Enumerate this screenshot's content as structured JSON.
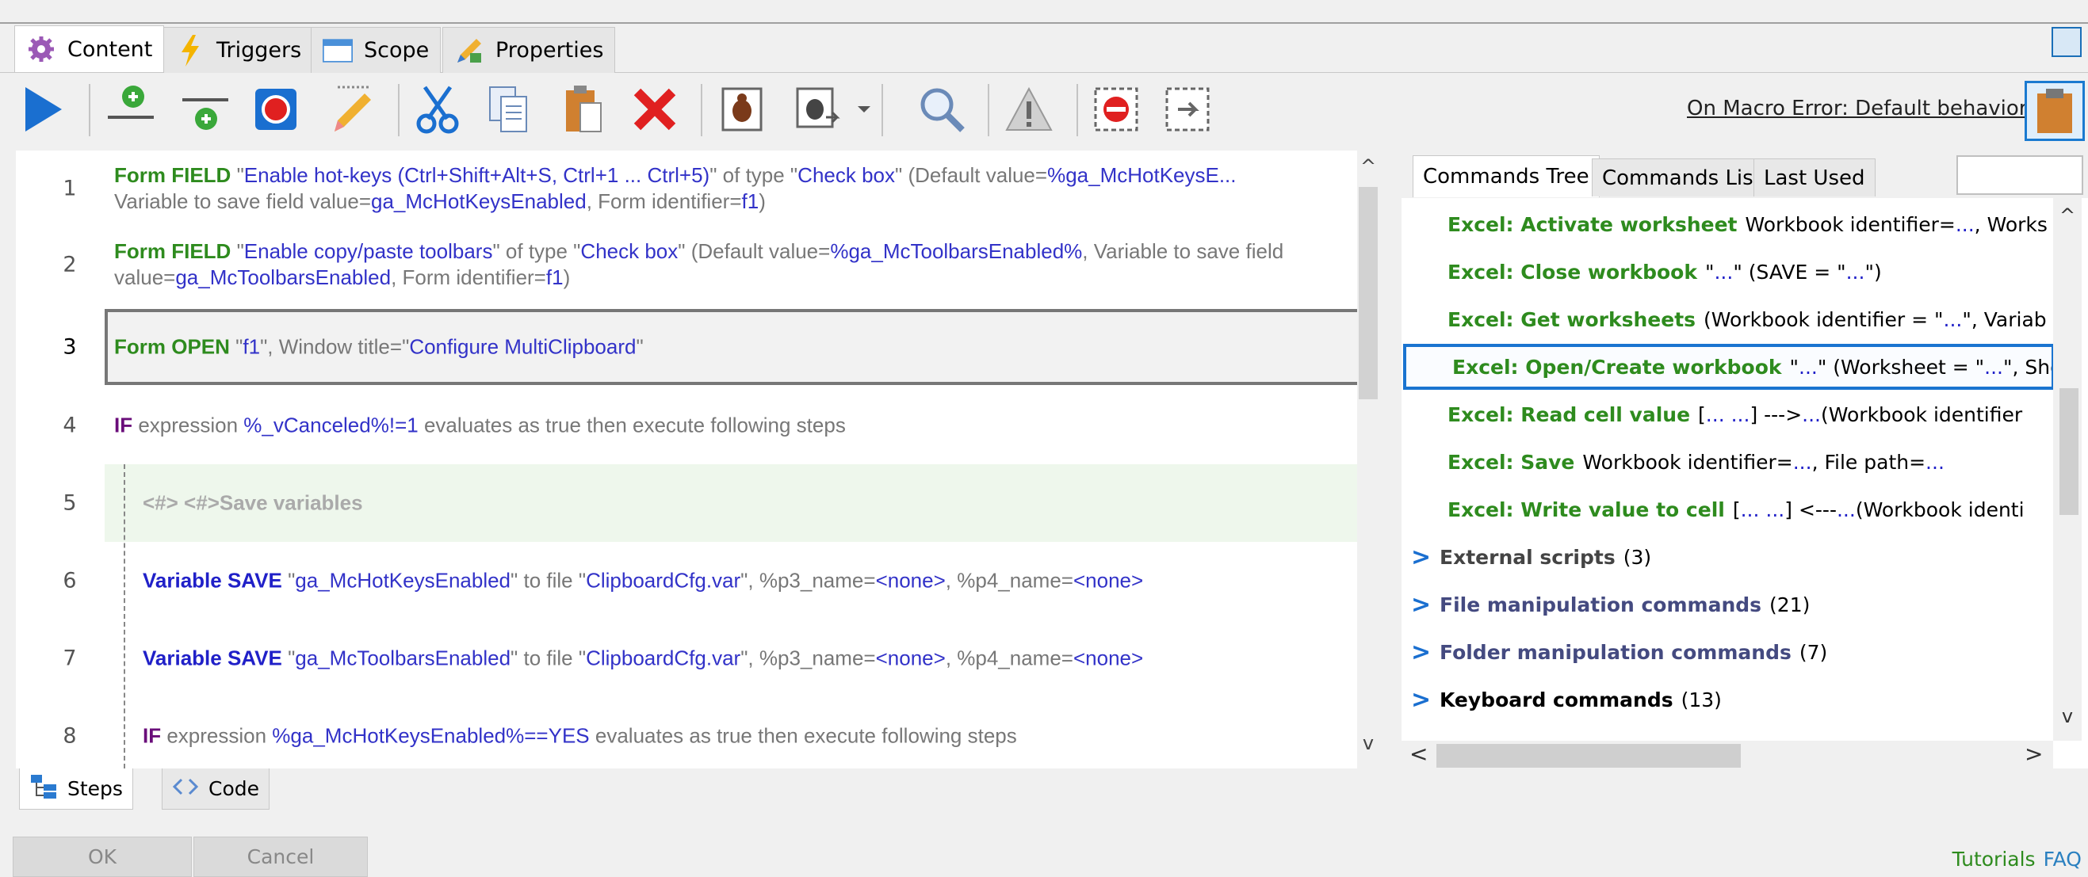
{
  "top_tabs": [
    {
      "label": "Content"
    },
    {
      "label": "Triggers"
    },
    {
      "label": "Scope"
    },
    {
      "label": "Properties"
    }
  ],
  "toolbar": {
    "on_error_link": "On Macro Error: Default behavior"
  },
  "steps": [
    {
      "num": "1",
      "k": "Form FIELD",
      "a": " \"",
      "b": "Enable hot-keys (Ctrl+Shift+Alt+S, Ctrl+1 ... Ctrl+5)",
      "c": "\" of type \"",
      "d": "Check box",
      "e": "\" (Default value=",
      "f": "%ga_McHotKeysE...",
      "g": "Variable to save field value=",
      "h": "ga_McHotKeysEnabled",
      "i": ", Form identifier=",
      "j": "f1",
      "k2": ")"
    },
    {
      "num": "2",
      "k": "Form FIELD",
      "a": " \"",
      "b": "Enable copy/paste toolbars",
      "c": "\" of type \"",
      "d": "Check box",
      "e": "\" (Default value=",
      "f": "%ga_McToolbarsEnabled%",
      "g": ", Variable to save field value=",
      "h": "ga_McToolbarsEnabled",
      "i": ", Form identifier=",
      "j": "f1",
      "k2": ")"
    },
    {
      "num": "3",
      "k": "Form OPEN",
      "a": " \"",
      "b": "f1",
      "c": "\", Window title=\"",
      "d": "Configure MultiClipboard",
      "e": "\""
    },
    {
      "num": "4",
      "k": "IF",
      "a": " expression ",
      "b": "%_vCanceled%!=1",
      "c": " evaluates as true then execute following steps"
    },
    {
      "num": "5",
      "k": "<#> <#>Save variables"
    },
    {
      "num": "6",
      "k": "Variable SAVE",
      "a": " \"",
      "b": "ga_McHotKeysEnabled",
      "c": "\" to file \"",
      "d": "ClipboardCfg.var",
      "e": "\", %p3_name=",
      "f": "<none>",
      "g": ", %p4_name=",
      "h": "<none>"
    },
    {
      "num": "7",
      "k": "Variable SAVE",
      "a": " \"",
      "b": "ga_McToolbarsEnabled",
      "c": "\" to file \"",
      "d": "ClipboardCfg.var",
      "e": "\", %p3_name=",
      "f": "<none>",
      "g": ", %p4_name=",
      "h": "<none>"
    },
    {
      "num": "8",
      "k": "IF",
      "a": " expression ",
      "b": "%ga_McHotKeysEnabled%==YES",
      "c": " evaluates as true then execute following steps"
    }
  ],
  "right_tabs": [
    {
      "label": "Commands Tree"
    },
    {
      "label": "Commands List"
    },
    {
      "label": "Last Used"
    }
  ],
  "tree": {
    "excel_items": [
      {
        "name": "Excel: Activate worksheet",
        "p1": " Workbook identifier=",
        "v1": "...",
        "p2": ", Worksh"
      },
      {
        "name": "Excel: Close workbook",
        "p1": " \"",
        "v1": "...",
        "p2": "\" (SAVE = \"",
        "v2": "...",
        "p3": "\")"
      },
      {
        "name": "Excel: Get worksheets",
        "p1": " (Workbook identifier = \"",
        "v1": "...",
        "p2": "\", Variable"
      },
      {
        "name": "Excel: Open/Create workbook",
        "p1": " \"",
        "v1": "...",
        "p2": "\" (Worksheet = \"",
        "v2": "...",
        "p3": "\", Sho"
      },
      {
        "name": "Excel: Read cell value",
        "p1": " [ ",
        "v1": "... ...",
        "p2": " ] ---> ",
        "v2": "...",
        "p3": " (Workbook identifier"
      },
      {
        "name": "Excel: Save",
        "p1": " Workbook identifier=",
        "v1": "...",
        "p2": ", File path=",
        "v2": "..."
      },
      {
        "name": "Excel: Write value to cell",
        "p1": " [ ",
        "v1": "... ...",
        "p2": " ] <--- ",
        "v2": "...",
        "p3": " (Workbook identi"
      }
    ],
    "categories": [
      {
        "name": "External scripts",
        "count": "(3)"
      },
      {
        "name": "File manipulation commands",
        "count": "(21)"
      },
      {
        "name": "Folder manipulation commands",
        "count": "(7)"
      },
      {
        "name": "Keyboard commands",
        "count": "(13)"
      }
    ]
  },
  "bottom_tabs": [
    {
      "label": "Steps"
    },
    {
      "label": "Code"
    }
  ],
  "footer": {
    "ok": "OK",
    "cancel": "Cancel",
    "tutorials": "Tutorials",
    "faq": "FAQ"
  }
}
